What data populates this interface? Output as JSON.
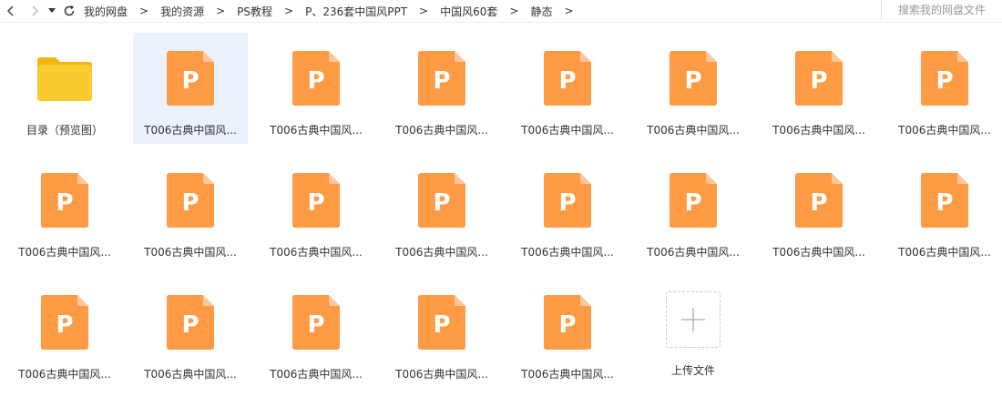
{
  "breadcrumb": [
    "我的网盘",
    "我的资源",
    "PS教程",
    "P、236套中国风PPT",
    "中国风60套",
    "静态"
  ],
  "breadcrumb_sep": ">",
  "search": {
    "placeholder": "搜索我的网盘文件"
  },
  "folder": {
    "label": "目录（预览图）"
  },
  "ppt_letter": "P",
  "files": [
    "T006古典中国风...",
    "T006古典中国风...",
    "T006古典中国风...",
    "T006古典中国风...",
    "T006古典中国风...",
    "T006古典中国风...",
    "T006古典中国风...",
    "T006古典中国风...",
    "T006古典中国风...",
    "T006古典中国风...",
    "T006古典中国风...",
    "T006古典中国风...",
    "T006古典中国风...",
    "T006古典中国风...",
    "T006古典中国风...",
    "T006古典中国风...",
    "T006古典中国风...",
    "T006古典中国风...",
    "T006古典中国风...",
    "T006古典中国风..."
  ],
  "upload": {
    "label": "上传文件"
  },
  "colors": {
    "ppt_orange": "#ff9a45",
    "ppt_fold": "#ffc69a",
    "folder_yellow": "#f9cb2e",
    "folder_back": "#f2b40f",
    "selected_bg": "#ebf2fe"
  }
}
